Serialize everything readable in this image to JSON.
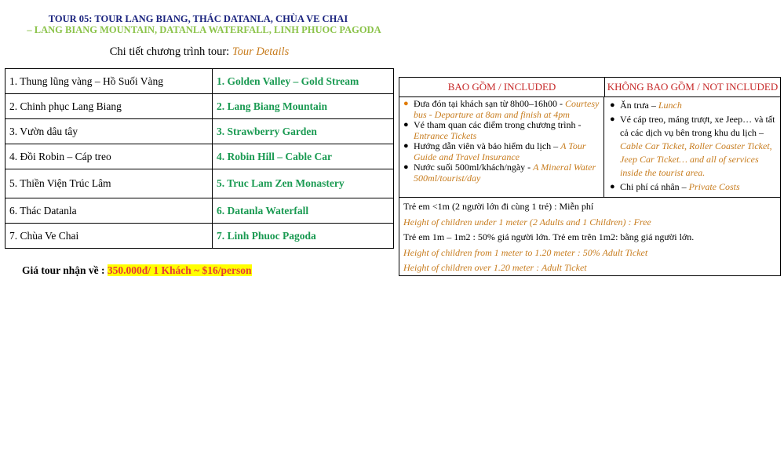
{
  "header": {
    "title_line1": "TOUR 05: TOUR LANG BIANG, THÁC DATANLA, CHÙA VE CHAI",
    "title_line2": "– LANG BIANG MOUNTAIN, DATANLA WATERFALL, LINH PHUOC PAGODA",
    "details_vi": "Chi tiết chương trình tour: ",
    "details_en": "Tour Details"
  },
  "itinerary": [
    {
      "vi": "1. Thung lũng vàng – Hồ Suối Vàng",
      "en": "1. Golden Valley – Gold Stream"
    },
    {
      "vi": "2. Chinh phục Lang Biang",
      "en": "2. Lang Biang Mountain"
    },
    {
      "vi": "3. Vườn dâu tây",
      "en": "3. Strawberry Garden"
    },
    {
      "vi": "4. Đồi Robin – Cáp treo",
      "en": "4. Robin Hill – Cable Car"
    },
    {
      "vi": "5. Thiền Viện Trúc Lâm",
      "en": "5. Truc Lam Zen Monastery"
    },
    {
      "vi": "6. Thác Datanla",
      "en": "6. Datanla Waterfall"
    },
    {
      "vi": "7. Chùa Ve Chai",
      "en": "7. Linh Phuoc Pagoda"
    }
  ],
  "price": {
    "label": "Giá tour nhận về : ",
    "value": "350.000đ/ 1 Khách ~ $16/person"
  },
  "included": {
    "header": "BAO GỒM / INCLUDED",
    "items": [
      {
        "vi": "Đưa đón tại khách sạn từ 8h00–16h00 - ",
        "en": "Courtesy bus - Departure at 8am and finish at 4pm"
      },
      {
        "vi": "Vé tham quan các điểm trong chương trình - ",
        "en": "Entrance Tickets"
      },
      {
        "vi": "Hướng dẫn viên và bảo hiểm du lịch – ",
        "en": "A Tour Guide and Travel Insurance"
      },
      {
        "vi": "Nước suối 500ml/khách/ngày - ",
        "en": "A Mineral Water 500ml/tourist/day"
      }
    ]
  },
  "not_included": {
    "header": "KHÔNG BAO GỒM / NOT INCLUDED",
    "items": [
      {
        "vi": "Ăn trưa – ",
        "en": "Lunch"
      },
      {
        "vi": "Vé cáp treo, máng trượt, xe Jeep… và tất cả các dịch vụ bên trong khu du lịch – ",
        "en": "Cable Car Ticket, Roller Coaster Ticket, Jeep Car Ticket… and all of services inside the tourist area."
      },
      {
        "vi": "Chi phí cá nhân – ",
        "en": "Private Costs"
      }
    ]
  },
  "children": {
    "line1": "Trẻ em <1m (2 người lớn đi cùng 1 trẻ) : Miễn phí",
    "line2": "Height of children under 1 meter (2 Adults and 1 Children) : Free",
    "line3": "Trẻ em 1m – 1m2 : 50% giá người lớn. Trẻ em trên 1m2: bằng giá người lớn.",
    "line4": "Height of children from 1 meter to 1.20 meter : 50% Adult Ticket",
    "line5": "Height of children over 1.20 meter : Adult Ticket"
  },
  "colors": {
    "title_navy": "#1a237e",
    "title_green": "#8bc34a",
    "itinerary_green": "#1a9a52",
    "english_orange": "#c77c1e",
    "header_red": "#c62828",
    "price_highlight": "#ffff00",
    "price_text": "#e53935"
  }
}
